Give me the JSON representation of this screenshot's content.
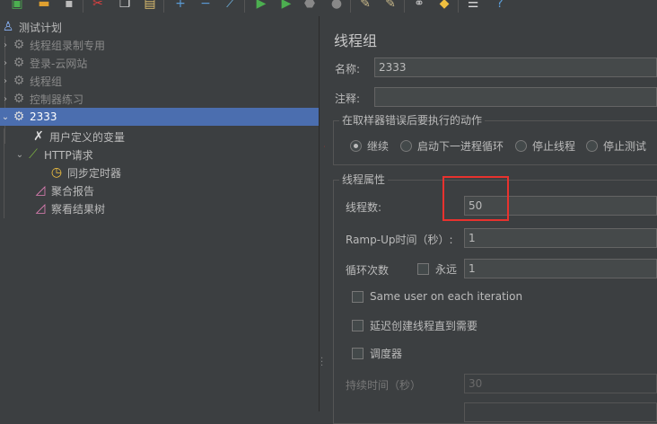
{
  "toolbar": {
    "icons": [
      "open-icon",
      "folder-icon",
      "save-icon",
      "cut-icon",
      "copy-icon",
      "paste-icon",
      "expand-icon",
      "collapse-icon",
      "toggle-icon",
      "start-icon",
      "start-no-pause-icon",
      "stop-icon",
      "shutdown-icon",
      "clear-icon",
      "clear-all-icon",
      "search-icon",
      "reset-search-icon",
      "function-helper-icon",
      "help-icon"
    ]
  },
  "tree": {
    "root": "测试计划",
    "items": [
      {
        "label": "线程组录制专用"
      },
      {
        "label": "登录-云网站"
      },
      {
        "label": "线程组"
      },
      {
        "label": "控制器练习"
      },
      {
        "label": "2333"
      },
      {
        "label": "用户定义的变量"
      },
      {
        "label": "HTTP请求"
      },
      {
        "label": "同步定时器"
      },
      {
        "label": "聚合报告"
      },
      {
        "label": "察看结果树"
      }
    ]
  },
  "panel": {
    "title": "线程组",
    "name_label": "名称:",
    "name_value": "2333",
    "comment_label": "注释:",
    "comment_value": "",
    "error_group_label": "在取样器错误后要执行的动作",
    "actions": [
      "继续",
      "启动下一进程循环",
      "停止线程",
      "停止测试"
    ],
    "selected_action": 0,
    "props_group_label": "线程属性",
    "threads_label": "线程数:",
    "threads_value": "50",
    "rampup_label": "Ramp-Up时间（秒）:",
    "rampup_value": "1",
    "loop_label": "循环次数",
    "forever_label": "永远",
    "loop_value": "1",
    "same_user_label": "Same user on each iteration",
    "delay_label": "延迟创建线程直到需要",
    "scheduler_label": "调度器",
    "duration_label": "持续时间（秒）",
    "duration_value": "30"
  },
  "colors": {
    "background": "#3c3f41",
    "selection": "#4b6eaf",
    "highlight": "#e8322e"
  }
}
